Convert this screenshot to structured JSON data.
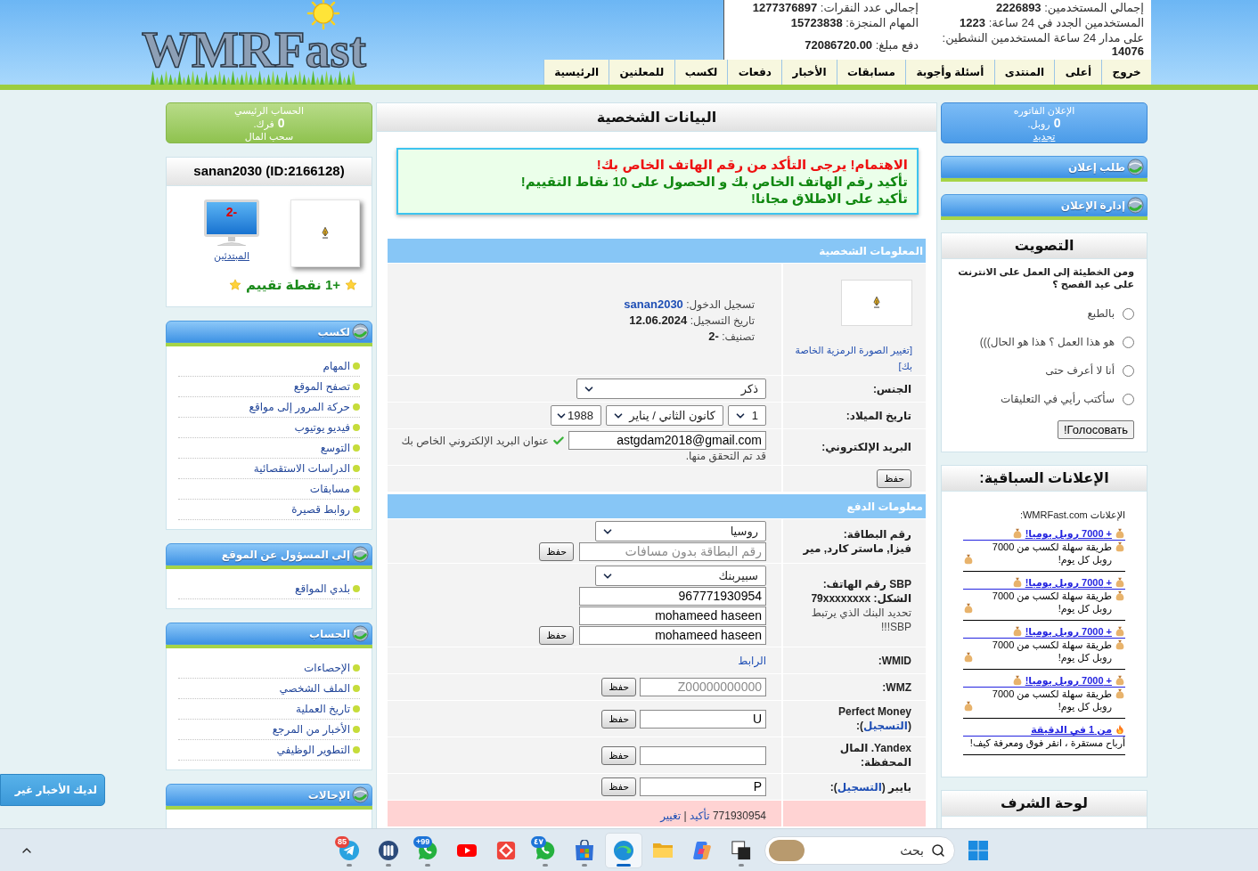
{
  "header": {
    "logo": "WMRFast",
    "stats": [
      {
        "label": "إجمالي المستخدمين:",
        "value": "2226893"
      },
      {
        "label": "إجمالي عدد النقرات:",
        "value": "1277376897"
      },
      {
        "label": "المستخدمين الجدد في 24 ساعة:",
        "value": "1223"
      },
      {
        "label": "المهام المنجزة:",
        "value": "15723838"
      },
      {
        "label": "على مدار 24 ساعة المستخدمين النشطين:",
        "value": "14076"
      },
      {
        "label": "دفع مبلغ:",
        "value": "72086720.00"
      }
    ],
    "nav": [
      "خروج",
      "أعلى",
      "المنتدى",
      "أسئلة وأجوبة",
      "مسابقات",
      "الأخبار",
      "دفعات",
      "لكسب",
      "للمعلنين",
      "الرئيسية"
    ]
  },
  "right_sidebar": {
    "ad_balance": {
      "title": "الإعلان الفاتوره",
      "amount": "0",
      "currency": "روبل.",
      "action": "تجديد"
    },
    "menus": [
      {
        "title": "طلب إعلان"
      },
      {
        "title": "إدارة الإعلان"
      }
    ],
    "poll": {
      "title": "التصويت",
      "question": "ومن الخطيئة إلى العمل على الانترنت على عيد الفصح ؟",
      "options": [
        {
          "label": "بالطبع",
          "selected": false
        },
        {
          "label": "هو هذا العمل ؟ هذا هو الحال)))",
          "selected": false
        },
        {
          "label": "أنا لا أعرف حتى",
          "selected": false
        },
        {
          "label": "سأكتب رأيي في التعليقات",
          "selected": false
        }
      ],
      "button": "Голосовать!"
    },
    "ads": {
      "title": "الإعلانات السباقية:",
      "intro": "الإعلانات WMRFast.com:",
      "items": [
        {
          "kind": "money",
          "link": "+ 7000 روبل يوميا!",
          "text": "طريقة سهلة لكسب من 7000 روبل كل يوم!"
        },
        {
          "kind": "money",
          "link": "+ 7000 روبل يوميا!",
          "text": "طريقة سهلة لكسب من 7000 روبل كل يوم!"
        },
        {
          "kind": "money",
          "link": "+ 7000 روبل يوميا!",
          "text": "طريقة سهلة لكسب من 7000 روبل كل يوم!"
        },
        {
          "kind": "money",
          "link": "+ 7000 روبل يوميا!",
          "text": "طريقة سهلة لكسب من 7000 روبل كل يوم!"
        },
        {
          "kind": "fire",
          "link": "من 1 في الدقيقة",
          "text": "أرباح مستقرة ، انقر فوق ومعرفة كيف!"
        }
      ]
    },
    "honor_board": {
      "title": "لوحة الشرف"
    }
  },
  "main": {
    "title": "البيانات الشخصية",
    "alert": [
      {
        "text": "الاهتمام! يرجى التأكد من رقم الهاتف الخاص بك!",
        "color": "#ee1111"
      },
      {
        "text": "تأكيد رقم الهاتف الخاص بك و الحصول على 10 نقاط التقييم!",
        "color": "#118811"
      },
      {
        "text": "تأكيد على الاطلاق مجانا!",
        "color": "#118811"
      }
    ],
    "personal": {
      "title": "المعلومات الشخصية",
      "avatar_link": "[تغيير الصورة الرمزية الخاصة بك]",
      "info": [
        {
          "label": "تسجيل الدخول:",
          "value": "sanan2030",
          "kind": "link"
        },
        {
          "label": "تاريخ التسجيل:",
          "value": "12.06.2024",
          "kind": "text"
        },
        {
          "label": "تصنيف:",
          "value": "-2",
          "kind": "text"
        }
      ],
      "rows": [
        {
          "kind": "select",
          "label": [
            {
              "kind": "title",
              "text": "الجنس:"
            }
          ],
          "select": "ذكر"
        },
        {
          "kind": "date",
          "label": [
            {
              "kind": "title",
              "text": "تاريخ الميلاد:"
            }
          ],
          "selects": [
            "1",
            "كانون الثاني / يناير",
            "1988"
          ]
        },
        {
          "kind": "email",
          "label": [
            {
              "kind": "title",
              "text": "البريد الإلكتروني:"
            }
          ],
          "value": "astgdam2018@gmail.com",
          "verified": true,
          "note": "عنوان البريد الإلكتروني الخاص بك",
          "note_after": "قد تم التحقق منها."
        },
        {
          "kind": "save",
          "button": "حفظ"
        }
      ]
    },
    "payment": {
      "title": "معلومات الدفع",
      "rows": [
        {
          "kind": "bank",
          "label": [
            {
              "kind": "title",
              "text": "رقم البطاقة:"
            },
            {
              "kind": "title",
              "text": "فيزا, ماستر كارد, مير"
            }
          ],
          "select": "روسيا",
          "inputs": [
            {
              "placeholder": "رقم البطاقة بدون مسافات"
            }
          ],
          "button": "حفظ"
        },
        {
          "kind": "bank",
          "label": [
            {
              "kind": "title",
              "text": "SBP رقم الهاتف:"
            },
            {
              "kind": "title",
              "text": "الشكل: 79xxxxxxxx"
            },
            {
              "kind": "hint",
              "text": "تحديد البنك الذي يرتبط SBP!!!"
            }
          ],
          "select": "سبيربنك",
          "inputs": [
            {
              "value": "967771930954"
            },
            {
              "value": "mohameed haseen"
            },
            {
              "value": "mohameed haseen"
            }
          ],
          "button": "حفظ"
        },
        {
          "kind": "link",
          "label": [
            {
              "kind": "title",
              "text": "WMID:"
            }
          ],
          "link": "الرابط"
        },
        {
          "kind": "wallet",
          "label": [
            {
              "kind": "title",
              "text": "WMZ:"
            }
          ],
          "input": {
            "placeholder": "Z00000000000"
          },
          "button": "حفظ"
        },
        {
          "kind": "wallet",
          "label": [
            {
              "kind": "title",
              "text": "Perfect Money"
            },
            {
              "kind": "title",
              "before": "(",
              "link": "التسجيل",
              "after": "):"
            }
          ],
          "input": {
            "value": "U"
          },
          "button": "حفظ"
        },
        {
          "kind": "wallet",
          "label": [
            {
              "kind": "title",
              "text": "Yandex. المال"
            },
            {
              "kind": "title",
              "text": "المحفظة:"
            }
          ],
          "button": "حفظ"
        },
        {
          "kind": "wallet",
          "label": [
            {
              "kind": "title",
              "before": "بايبر (",
              "link": "التسجيل",
              "after": "):"
            }
          ],
          "input": {
            "value": "P"
          },
          "button": "حفظ"
        },
        {
          "kind": "notice",
          "text": "771930954",
          "links": [
            "تأكيد",
            "تغيير"
          ],
          "separator": "|"
        }
      ]
    }
  },
  "left_sidebar": {
    "balance": {
      "title": "الحساب الرئيسي",
      "amount": "0",
      "currency": "فرك.",
      "action": "سحب المال"
    },
    "profile": {
      "name": "sanan2030 (ID:2166128)",
      "level_value": "-2",
      "level_name": "المبتدئين",
      "rating": "+1 نقطة تقييم"
    },
    "menus": [
      {
        "title": "لكسب",
        "items": [
          "المهام",
          "تصفح الموقع",
          "حركة المرور إلى مواقع",
          "فيديو يوتيوب",
          "التوسع",
          "الدراسات الاستقصائية",
          "مسابقات",
          "روابط قصيرة"
        ]
      },
      {
        "title": "إلى المسؤول عن الموقع",
        "items": [
          "بلدي المواقع"
        ]
      },
      {
        "title": "الحساب",
        "items": [
          "الإحصاءات",
          "الملف الشخصي",
          "تاريخ العملية",
          "الأخبار من المرجع",
          "التطوير الوظيفي"
        ]
      },
      {
        "title": "الإحالات"
      }
    ]
  },
  "news_tab": "لديك الأخبار غير",
  "taskbar": {
    "items": [
      {
        "kind": "start",
        "running": false,
        "selected": false
      },
      {
        "kind": "search",
        "placeholder": "بحث"
      },
      {
        "kind": "squares",
        "running": true,
        "selected": false
      },
      {
        "kind": "swirl",
        "running": false,
        "selected": false
      },
      {
        "kind": "folder",
        "running": false,
        "selected": false
      },
      {
        "kind": "browser",
        "running": true,
        "selected": true
      },
      {
        "kind": "store",
        "running": true,
        "selected": false
      },
      {
        "kind": "chat",
        "badge": "٤٧",
        "running": true,
        "selected": false
      },
      {
        "kind": "diamond",
        "running": false,
        "selected": false
      },
      {
        "kind": "video",
        "running": false,
        "selected": false
      },
      {
        "kind": "chat",
        "badge": "+99",
        "running": true,
        "selected": false
      },
      {
        "kind": "bars",
        "running": true,
        "selected": false
      },
      {
        "kind": "plane",
        "badge": "85",
        "running": true,
        "selected": false
      }
    ]
  }
}
